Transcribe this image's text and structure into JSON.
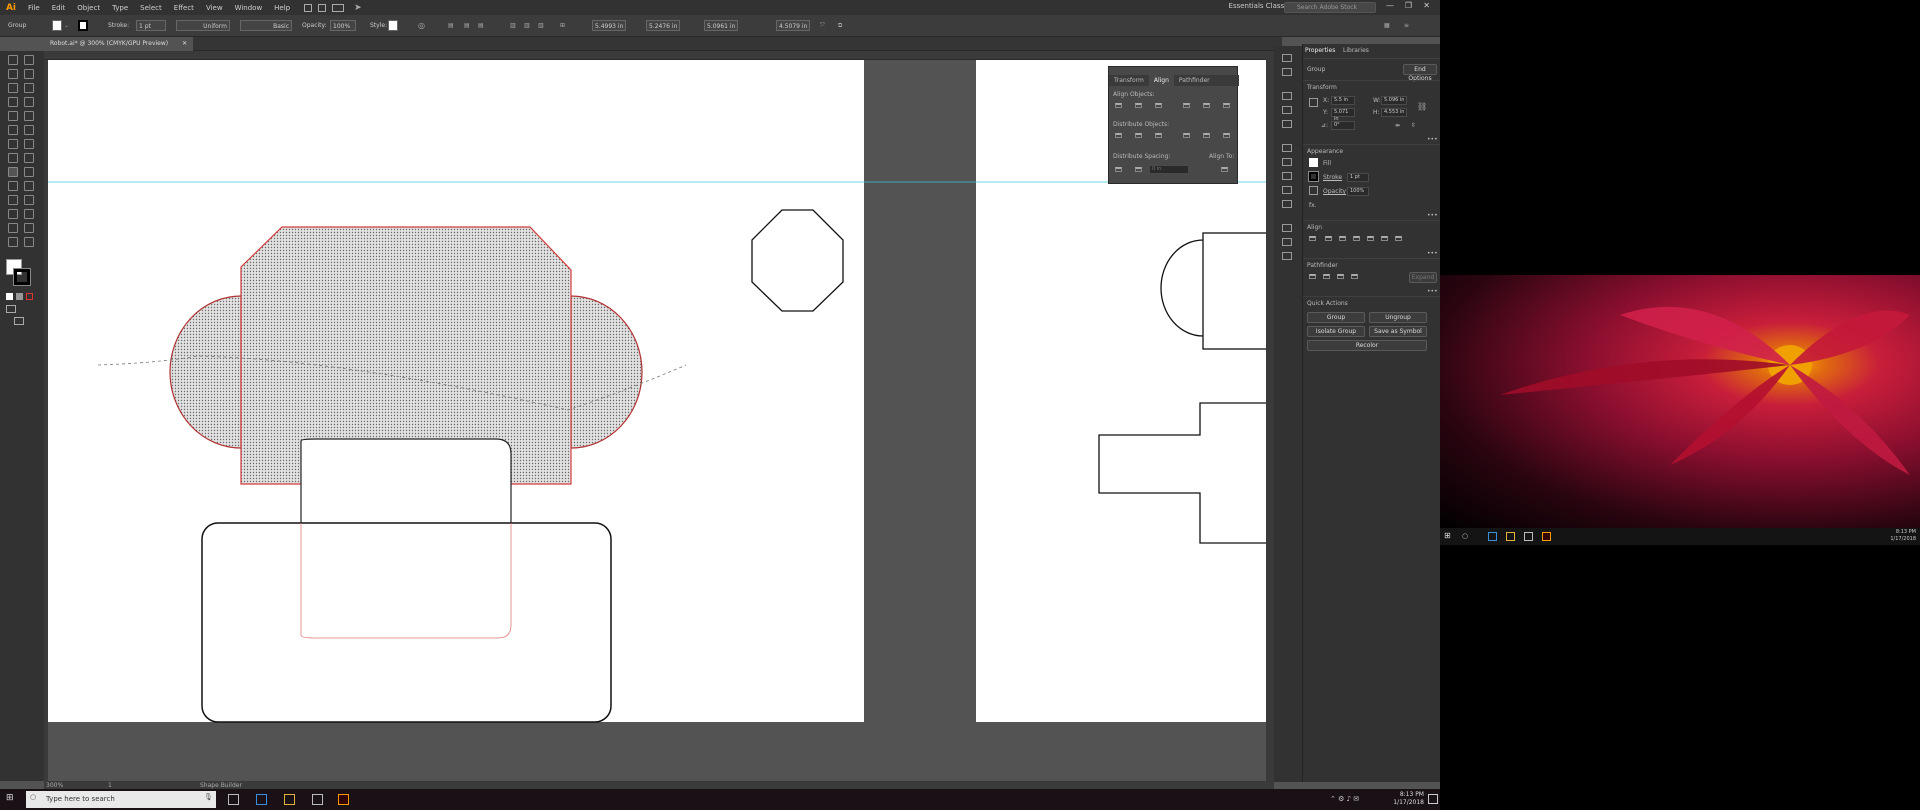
{
  "app": {
    "logo": "Ai",
    "title": "Robot.ai* @ 300% (CMYK/GPU Preview)",
    "workspace": "Essentials Classic",
    "stock_placeholder": "Search Adobe Stock",
    "win_min": "—",
    "win_max": "❐",
    "win_close": "✕"
  },
  "menu": [
    "File",
    "Edit",
    "Object",
    "Type",
    "Select",
    "Effect",
    "View",
    "Window",
    "Help"
  ],
  "control": {
    "selection": "Group",
    "stroke_label": "Stroke:",
    "stroke_value": "1 pt",
    "stroke_style": "Uniform",
    "brush": "Basic",
    "opacity_label": "Opacity:",
    "opacity_value": "100%",
    "style_label": "Style:",
    "x_value": "5.4993 in",
    "y_value": "5.2476 in",
    "w_value": "5.0961 in",
    "h_value": "4.5079 in"
  },
  "status": {
    "zoom": "300%",
    "artboard": "1",
    "tool": "Shape Builder"
  },
  "properties": {
    "tabs": [
      "Properties",
      "Libraries"
    ],
    "group": "Group",
    "isolate": "Isolate Group",
    "end_options": "End Options",
    "transform": {
      "title": "Transform",
      "x": "5.5 in",
      "y": "5.071 in",
      "w": "5.096 in",
      "h": "4.553 in",
      "angle": "0°"
    },
    "appearance": {
      "title": "Appearance",
      "fill": "Fill",
      "stroke": "Stroke",
      "stroke_value": "1 pt",
      "opacity": "Opacity",
      "opacity_value": "100%",
      "fx": "fx."
    },
    "align_title": "Align",
    "pathfinder_title": "Pathfinder",
    "expand": "Expand",
    "quick_actions": {
      "title": "Quick Actions",
      "group": "Group",
      "ungroup": "Ungroup",
      "isolate": "Isolate Group",
      "save_symbol": "Save as Symbol",
      "recolor": "Recolor"
    }
  },
  "align_panel": {
    "tabs": [
      "Transform",
      "Align",
      "Pathfinder"
    ],
    "align_objects": "Align Objects:",
    "distribute_objects": "Distribute Objects:",
    "distribute_spacing": "Distribute Spacing:",
    "align_to": "Align To:",
    "spacing_value": "0 in"
  },
  "taskbar": {
    "search_placeholder": "Type here to search",
    "time": "8:13 PM",
    "date": "1/17/2018"
  },
  "second_monitor": {
    "time": "8:13 PM",
    "date": "1/17/2018"
  },
  "colors": {
    "accent": "#ff9a00",
    "selection": "#d23b3b",
    "guide": "#3ec6d6",
    "ui_dark": "#323232",
    "ui_mid": "#535353"
  }
}
